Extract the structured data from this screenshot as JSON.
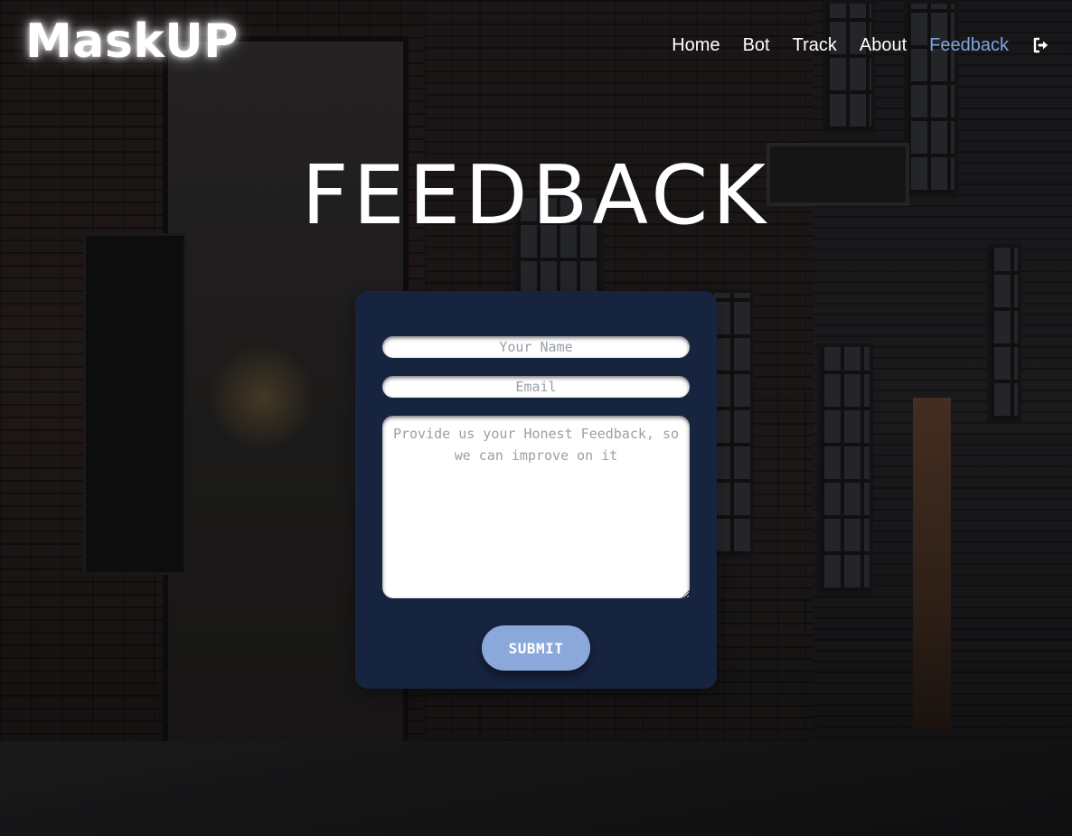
{
  "brand": {
    "logo": "MaskUP"
  },
  "nav": {
    "items": [
      {
        "label": "Home",
        "active": false
      },
      {
        "label": "Bot",
        "active": false
      },
      {
        "label": "Track",
        "active": false
      },
      {
        "label": "About",
        "active": false
      },
      {
        "label": "Feedback",
        "active": true
      }
    ],
    "logout_icon": "sign-out-icon",
    "active_color": "#7fa6de"
  },
  "page": {
    "title": "FEEDBACK"
  },
  "form": {
    "name_placeholder": "Your Name",
    "email_placeholder": "Email",
    "feedback_placeholder": "Provide us your Honest Feedback, so we can improve on it",
    "submit_label": "SUBMIT",
    "card_color": "#172440",
    "submit_color": "#8aa8da"
  }
}
